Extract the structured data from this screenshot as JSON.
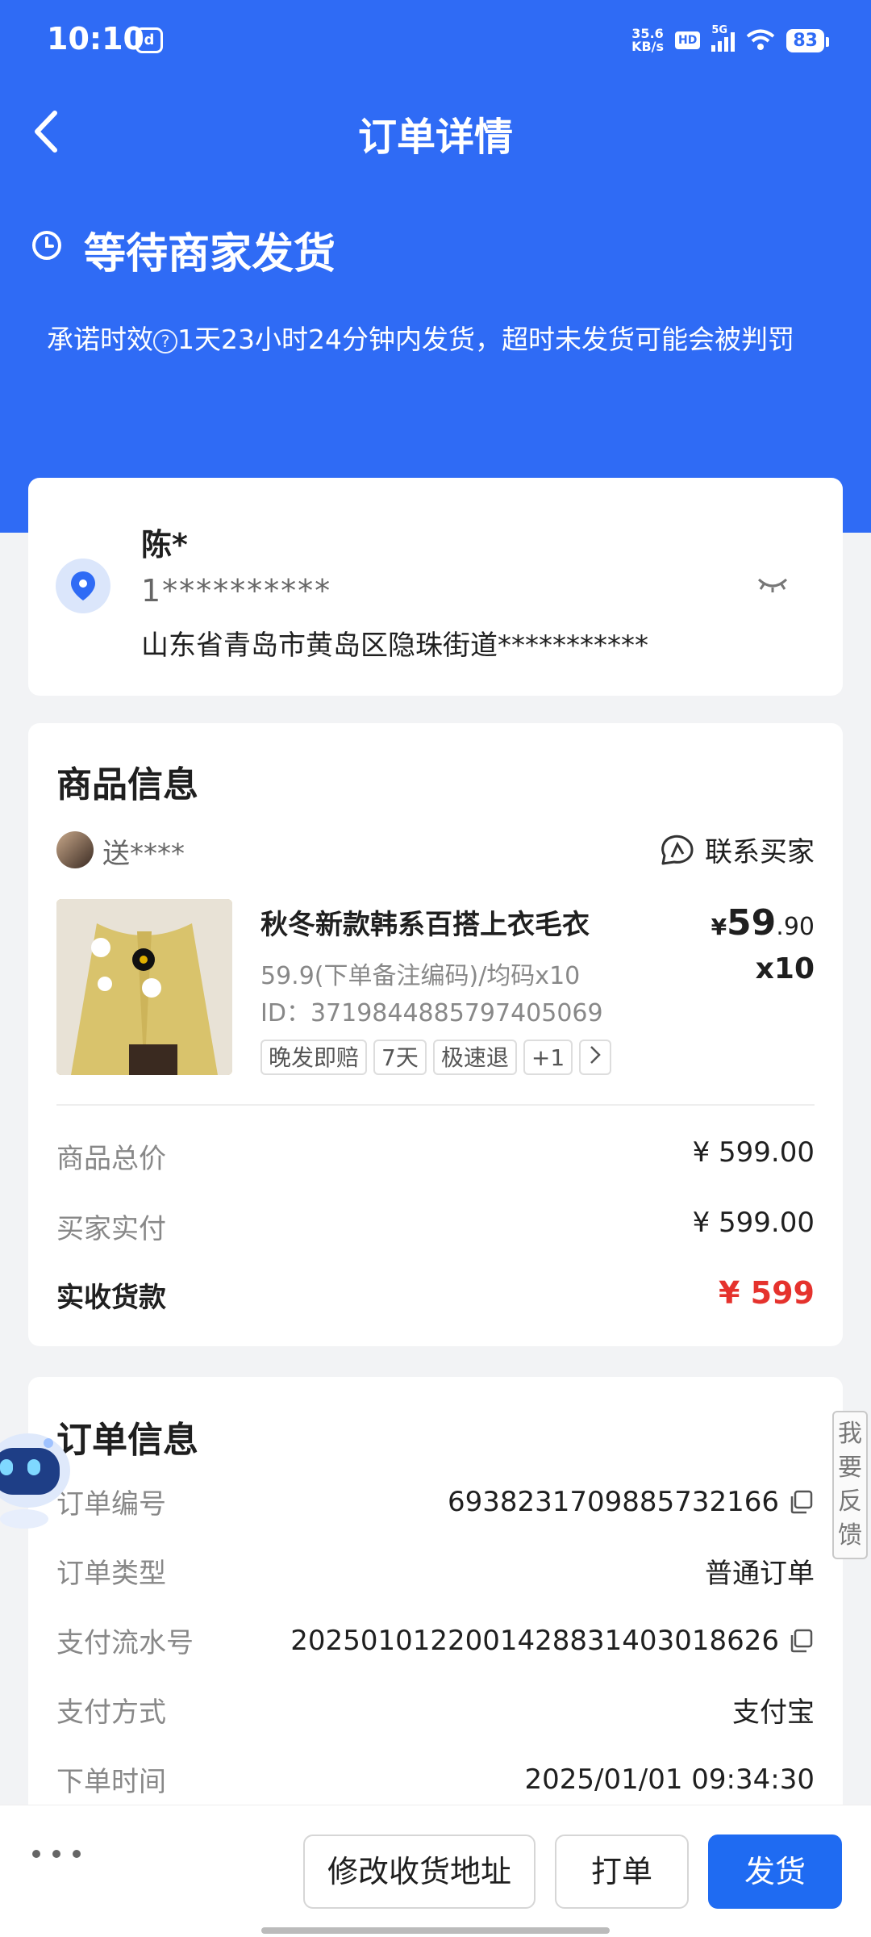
{
  "status_bar": {
    "time": "10:10",
    "app_icon": "app-notification-icon",
    "net_speed_top": "35.6",
    "net_speed_unit": "KB/s",
    "hd": "HD",
    "signal_label": "5G",
    "battery": "83"
  },
  "nav": {
    "title": "订单详情",
    "back_icon": "chevron-left-icon"
  },
  "status": {
    "title": "等待商家发货",
    "promise_prefix": "承诺时效",
    "promise_text": "1天23小时24分钟内发货，超时未发货可能会被判罚"
  },
  "address": {
    "name": "陈*",
    "phone": "1**********",
    "detail": "山东省青岛市黄岛区隐珠街道***********"
  },
  "goods": {
    "section_title": "商品信息",
    "buyer_name": "送****",
    "contact_label": "联系买家",
    "product": {
      "title": "秋冬新款韩系百搭上衣毛衣",
      "spec": "59.9(下单备注编码)/均码x10",
      "id": "ID：3719844885797405069",
      "price_symbol": "¥",
      "price_int": "59",
      "price_dec": ".90",
      "qty": "x10",
      "tags": [
        "晚发即赔",
        "7天",
        "极速退",
        "+1"
      ]
    },
    "summary": [
      {
        "label": "商品总价",
        "value": "¥ 599.00"
      },
      {
        "label": "买家实付",
        "value": "¥ 599.00"
      }
    ],
    "received": {
      "label": "实收货款",
      "value": "¥ 599"
    }
  },
  "order": {
    "section_title": "订单信息",
    "rows": [
      {
        "label": "订单编号",
        "value": "6938231709885732166",
        "copy": true
      },
      {
        "label": "订单类型",
        "value": "普通订单",
        "copy": false
      },
      {
        "label": "支付流水号",
        "value": "20250101220014288314030186​26",
        "copy": true
      },
      {
        "label": "支付方式",
        "value": "支付宝",
        "copy": false
      },
      {
        "label": "下单时间",
        "value": "2025/01/01 09:34:30",
        "copy": false
      }
    ]
  },
  "feedback": "我要反馈",
  "actions": {
    "modify_address": "修改收货地址",
    "print": "打单",
    "ship": "发货"
  },
  "colors": {
    "brand_blue": "#2f6bf5",
    "price_red": "#e5322d"
  }
}
